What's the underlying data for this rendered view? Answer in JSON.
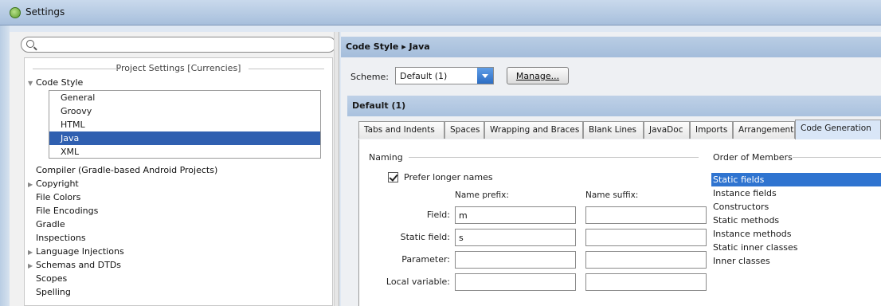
{
  "window": {
    "title": "Settings"
  },
  "search": {
    "value": "",
    "placeholder": ""
  },
  "project_settings_header": "Project Settings [Currencies]",
  "tree": {
    "code_style": "Code Style",
    "children": [
      "General",
      "Groovy",
      "HTML",
      "Java",
      "XML"
    ],
    "selected_child": "Java",
    "items": [
      "Compiler (Gradle-based Android Projects)",
      "Copyright",
      "File Colors",
      "File Encodings",
      "Gradle",
      "Inspections",
      "Language Injections",
      "Schemas and DTDs",
      "Scopes",
      "Spelling"
    ]
  },
  "breadcrumb": "Code Style ▸ Java",
  "scheme": {
    "label": "Scheme:",
    "value": "Default (1)",
    "manage_label": "Manage..."
  },
  "sub_header": "Default (1)",
  "tabs": [
    "Tabs and Indents",
    "Spaces",
    "Wrapping and Braces",
    "Blank Lines",
    "JavaDoc",
    "Imports",
    "Arrangement",
    "Code Generation"
  ],
  "active_tab": "Code Generation",
  "naming": {
    "title": "Naming",
    "prefer_longer_names": {
      "label": "Prefer longer names",
      "checked": true
    },
    "prefix_header": "Name prefix:",
    "suffix_header": "Name suffix:",
    "rows": [
      {
        "label": "Field:",
        "prefix": "m",
        "suffix": ""
      },
      {
        "label": "Static field:",
        "prefix": "s",
        "suffix": ""
      },
      {
        "label": "Parameter:",
        "prefix": "",
        "suffix": ""
      },
      {
        "label": "Local variable:",
        "prefix": "",
        "suffix": ""
      }
    ]
  },
  "order_of_members": {
    "title": "Order of Members",
    "items": [
      "Static fields",
      "Instance fields",
      "Constructors",
      "Static methods",
      "Instance methods",
      "Static inner classes",
      "Inner classes"
    ],
    "selected": "Static fields"
  },
  "colors": {
    "selection": "#2f5fb0",
    "header_bar": "#a4bddb"
  }
}
